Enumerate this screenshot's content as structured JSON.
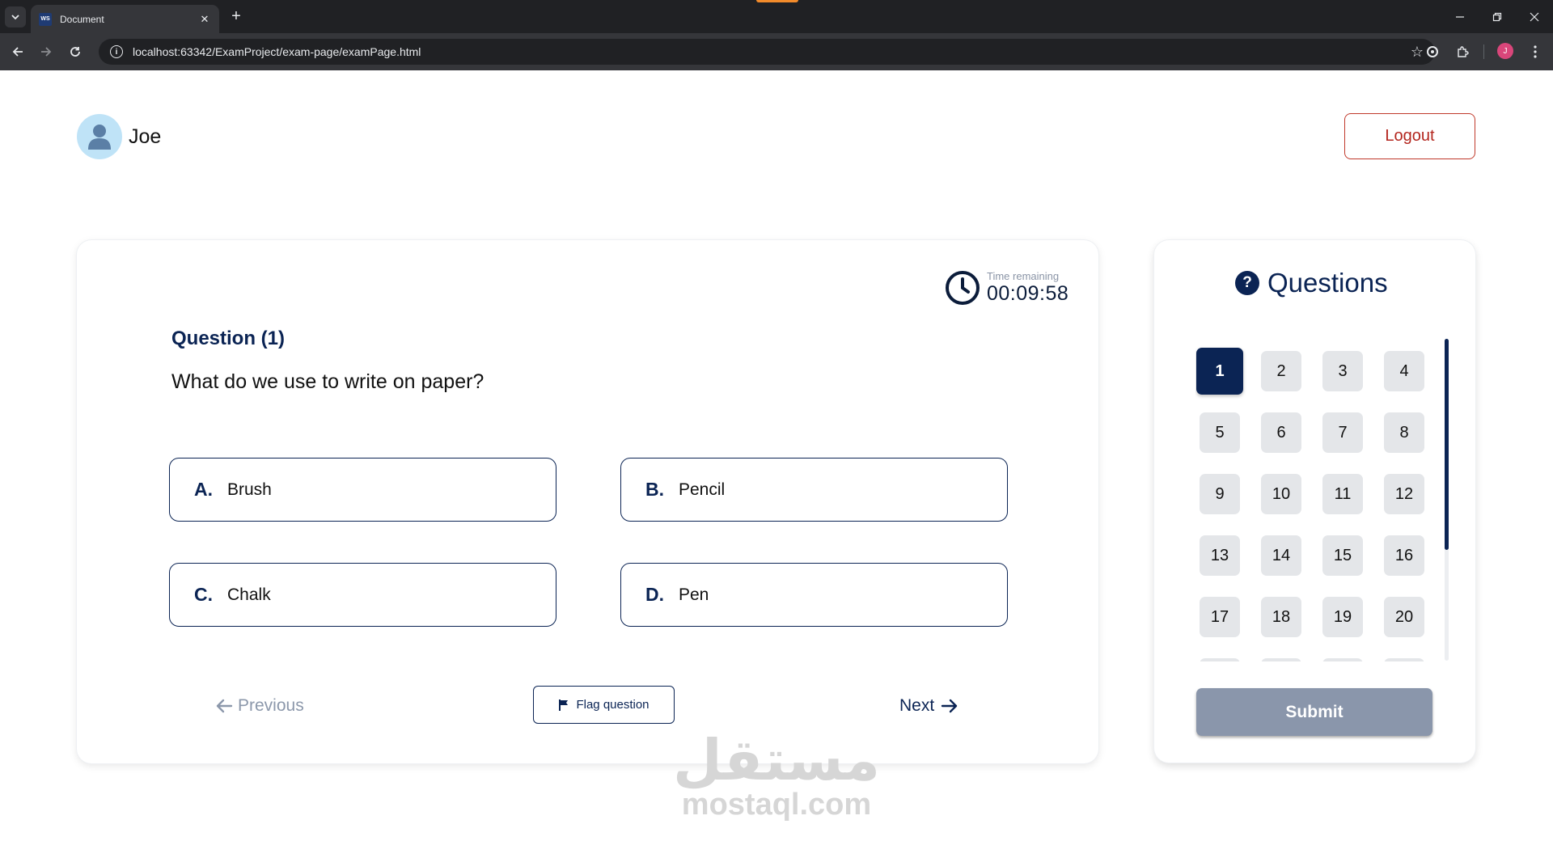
{
  "browser": {
    "tab_title": "Document",
    "tab_favicon_text": "WS",
    "url": "localhost:63342/ExamProject/exam-page/examPage.html",
    "profile_initial": "J",
    "accent_color": "#f28b2b"
  },
  "header": {
    "username": "Joe",
    "logout_label": "Logout"
  },
  "timer": {
    "label": "Time remaining",
    "value": "00:09:58"
  },
  "question": {
    "number_label": "Question (1)",
    "text": "What do we use to write on paper?",
    "options": [
      {
        "letter": "A.",
        "text": "Brush"
      },
      {
        "letter": "B.",
        "text": "Pencil"
      },
      {
        "letter": "C.",
        "text": "Chalk"
      },
      {
        "letter": "D.",
        "text": "Pen"
      }
    ]
  },
  "navigation": {
    "previous_label": "Previous",
    "flag_label": "Flag question",
    "next_label": "Next"
  },
  "questions_panel": {
    "title": "Questions",
    "help_glyph": "?",
    "current": "1",
    "numbers": [
      "1",
      "2",
      "3",
      "4",
      "5",
      "6",
      "7",
      "8",
      "9",
      "10",
      "11",
      "12",
      "13",
      "14",
      "15",
      "16",
      "17",
      "18",
      "19",
      "20"
    ],
    "submit_label": "Submit"
  },
  "watermark": {
    "arabic": "مستقل",
    "latin": "mostaql.com"
  },
  "colors": {
    "primary": "#0b2454",
    "danger": "#b3261e",
    "submit_disabled": "#8a96ab",
    "cell_bg": "#e4e6e9"
  }
}
